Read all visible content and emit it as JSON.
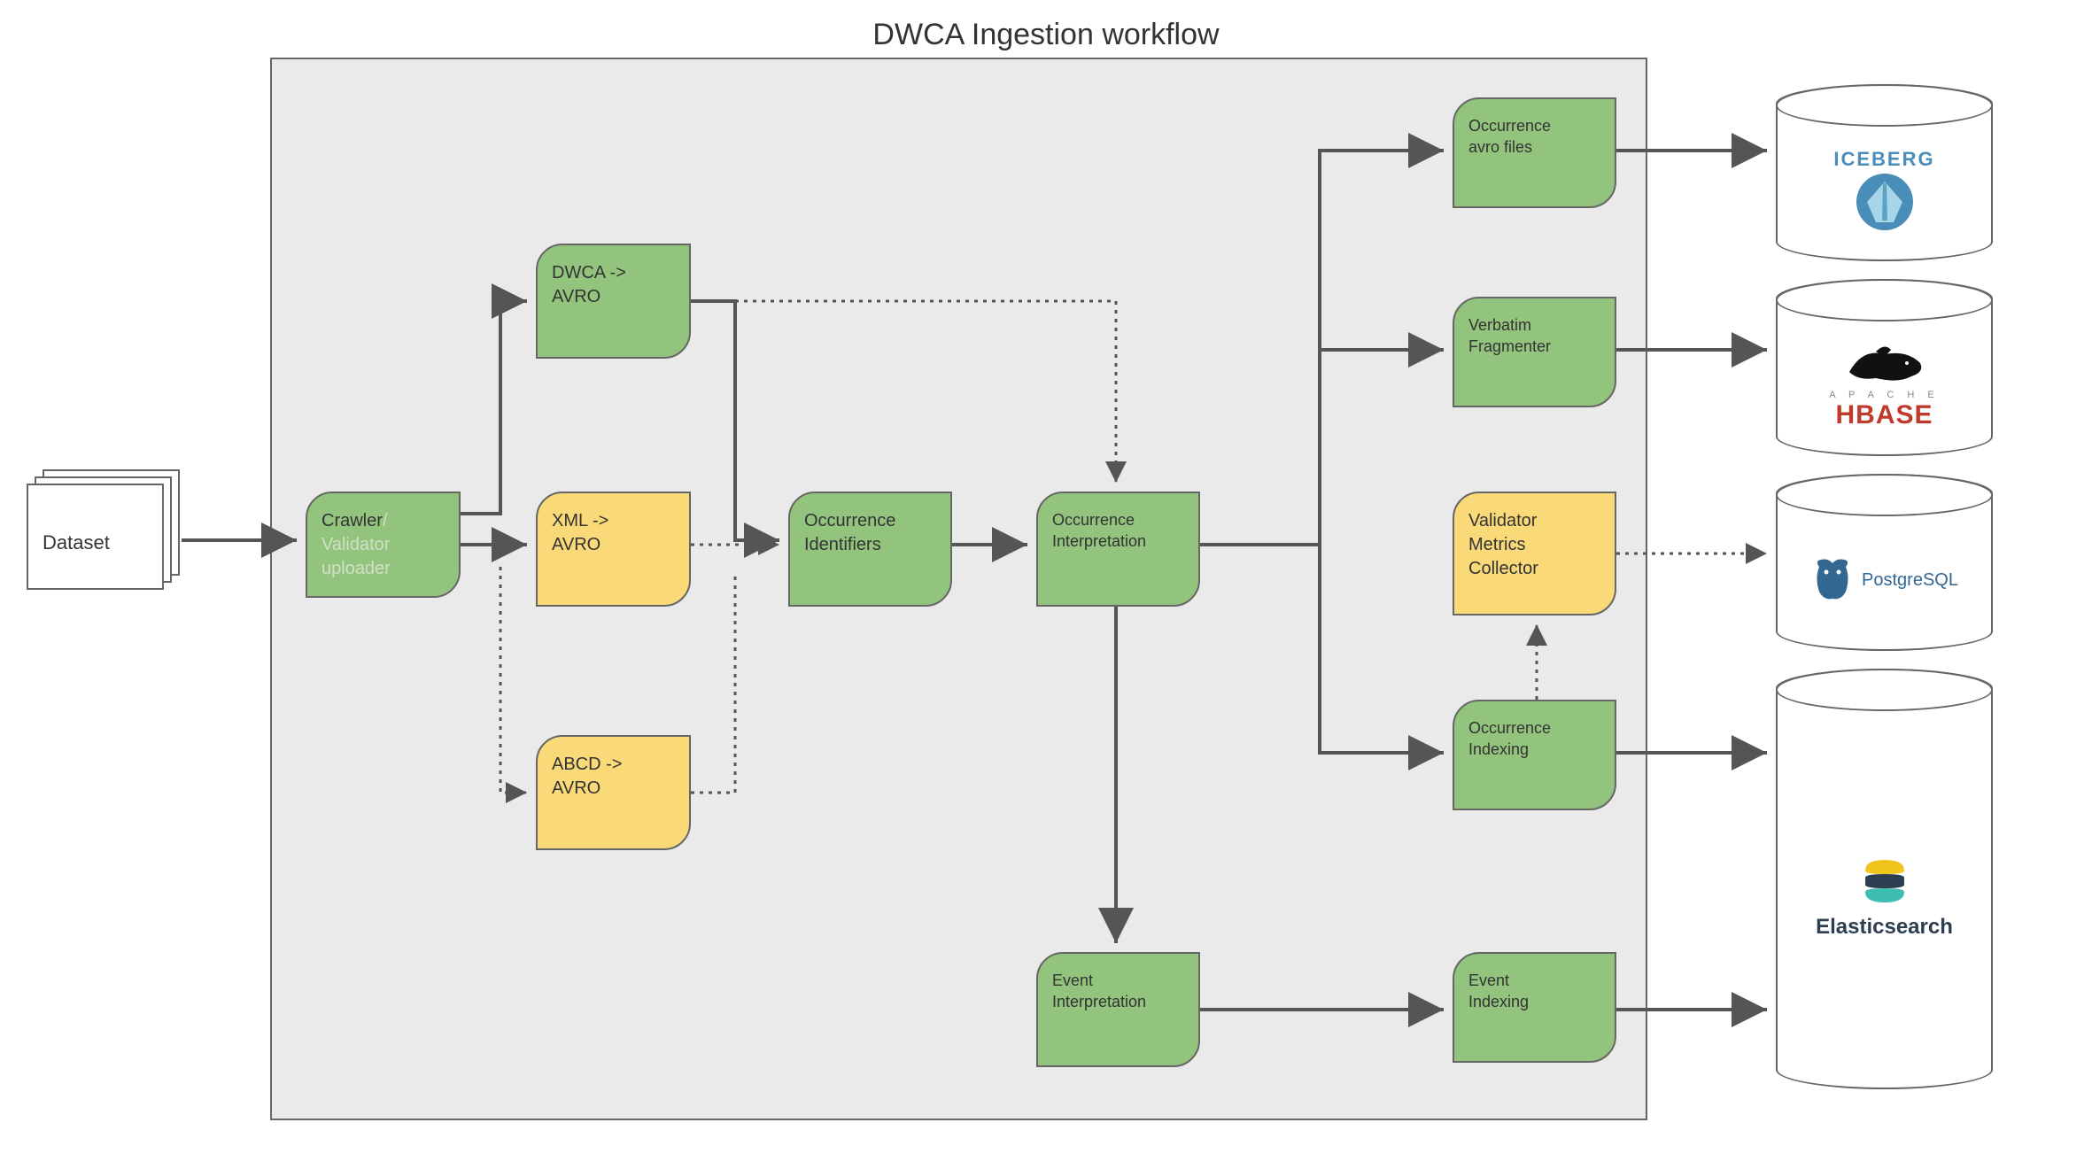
{
  "title": "DWCA Ingestion workflow",
  "dataset": {
    "label": "Dataset"
  },
  "nodes": {
    "crawler": {
      "line1": "Crawler",
      "line2": "Validator",
      "line3": "uploader",
      "slash": "/"
    },
    "dwca_avro": "DWCA ->\nAVRO",
    "xml_avro": "XML ->\nAVRO",
    "abcd_avro": "ABCD ->\nAVRO",
    "occ_identifiers": "Occurrence\nIdentifiers",
    "occ_interpretation": "Occurrence\nInterpretation",
    "event_interpretation": "Event\nInterpretation",
    "occ_avro_files": "Occurrence\navro files",
    "verbatim_fragmenter": "Verbatim\nFragmenter",
    "validator_metrics": "Validator\nMetrics\nCollector",
    "occ_indexing": "Occurrence\nIndexing",
    "event_indexing": "Event\nIndexing"
  },
  "storage": {
    "iceberg": "ICEBERG",
    "hbase_top": "A P A C H E",
    "hbase": "HBASE",
    "postgres": "PostgreSQL",
    "elastic": "Elasticsearch"
  },
  "colors": {
    "green": "#93c47d",
    "yellow": "#f9d978",
    "border": "#666666"
  }
}
